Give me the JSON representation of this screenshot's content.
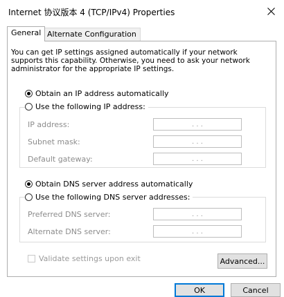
{
  "window": {
    "title": "Internet 协议版本 4 (TCP/IPv4) Properties",
    "close_icon": "close-icon"
  },
  "tabs": [
    {
      "label": "General",
      "active": true
    },
    {
      "label": "Alternate Configuration",
      "active": false
    }
  ],
  "intro_text": "You can get IP settings assigned automatically if your network supports this capability. Otherwise, you need to ask your network administrator for the appropriate IP settings.",
  "ip_section": {
    "auto_label": "Obtain an IP address automatically",
    "auto_selected": true,
    "manual_label": "Use the following IP address:",
    "manual_selected": false,
    "fields": [
      {
        "label": "IP address:",
        "value": ". . ."
      },
      {
        "label": "Subnet mask:",
        "value": ". . ."
      },
      {
        "label": "Default gateway:",
        "value": ". . ."
      }
    ]
  },
  "dns_section": {
    "auto_label": "Obtain DNS server address automatically",
    "auto_selected": true,
    "manual_label": "Use the following DNS server addresses:",
    "manual_selected": false,
    "fields": [
      {
        "label": "Preferred DNS server:",
        "value": ". . ."
      },
      {
        "label": "Alternate DNS server:",
        "value": ". . ."
      }
    ]
  },
  "validate_label": "Validate settings upon exit",
  "validate_checked": false,
  "buttons": {
    "advanced": "Advanced...",
    "ok": "OK",
    "cancel": "Cancel"
  }
}
